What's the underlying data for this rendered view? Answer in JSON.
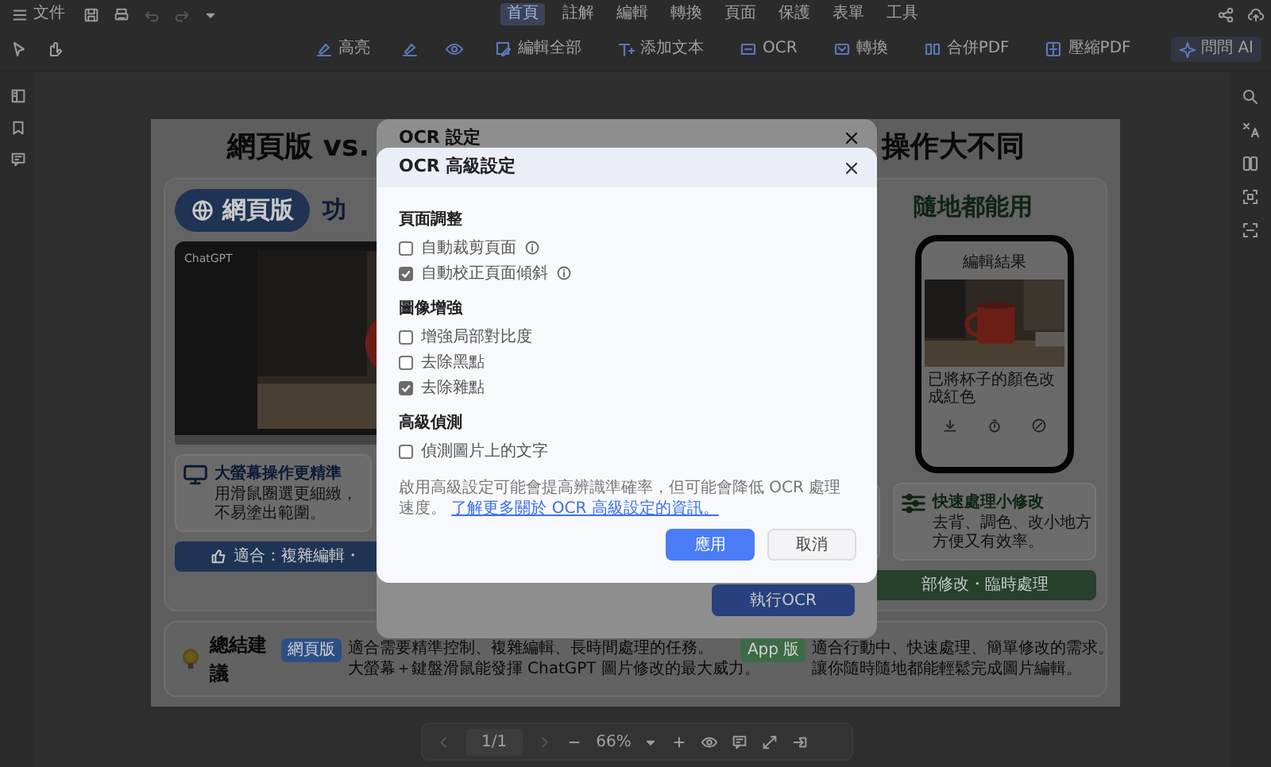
{
  "menu_bar": {
    "file_label": "文件",
    "tabs": [
      {
        "label": "首頁",
        "selected": true
      },
      {
        "label": "註解",
        "selected": false
      },
      {
        "label": "編輯",
        "selected": false
      },
      {
        "label": "轉換",
        "selected": false
      },
      {
        "label": "頁面",
        "selected": false
      },
      {
        "label": "保護",
        "selected": false
      },
      {
        "label": "表單",
        "selected": false
      },
      {
        "label": "工具",
        "selected": false
      }
    ]
  },
  "toolbar": {
    "tools": [
      {
        "kind": "labeled",
        "label": "高亮"
      },
      {
        "kind": "icon"
      },
      {
        "kind": "icon"
      },
      {
        "kind": "labeled",
        "label": "編輯全部"
      },
      {
        "kind": "labeled",
        "label": "添加文本"
      },
      {
        "kind": "labeled",
        "label": "OCR"
      },
      {
        "kind": "labeled",
        "label": "轉換"
      },
      {
        "kind": "labeled",
        "label": "合併PDF"
      },
      {
        "kind": "labeled",
        "label": "壓縮PDF"
      }
    ],
    "ai_button": "問問 AI"
  },
  "document": {
    "title_left": "網頁版 vs.",
    "title_right": "操作大不同",
    "web_card": {
      "badge": "網頁版",
      "next_heading": "功",
      "laptop_app": "ChatGPT",
      "feature": {
        "title": "大螢幕操作更精準",
        "lines": [
          "用滑鼠圈選更細緻，",
          "不易塗出範圍。"
        ]
      },
      "footer": "適合：複雜編輯・"
    },
    "app_card": {
      "heading": "隨地都能用",
      "phone_title": "編輯結果",
      "phone_caption": "已將杯子的顏色改成紅色",
      "feature": {
        "title": "快速處理小修改",
        "lines": [
          "去背、調色、改小地方",
          "方便又有效率。"
        ]
      },
      "footer": "部修改・臨時處理"
    },
    "summary": {
      "title": "總結建議",
      "items": [
        {
          "badge": "網頁版",
          "color": "#2c4f86",
          "lines": [
            "適合需要精準控制、複雜編輯、長時間處理的任務。",
            "大螢幕＋鍵盤滑鼠能發揮 ChatGPT 圖片修改的最大威力。"
          ]
        },
        {
          "badge": "App 版",
          "color": "#3d6b47",
          "lines": [
            "適合行動中、快速處理、簡單修改的需求。",
            "讓你隨時隨地都能輕鬆完成圖片編輯。"
          ]
        }
      ]
    }
  },
  "page_nav": {
    "page": "1/1",
    "zoom": "66%"
  },
  "ocr_dialog": {
    "title": "OCR 設定",
    "run_button": "執行OCR"
  },
  "advanced_dialog": {
    "title": "OCR 高級設定",
    "sections": [
      {
        "heading": "頁面調整",
        "options": [
          {
            "label": "自動裁剪頁面",
            "checked": false,
            "info": true
          },
          {
            "label": "自動校正頁面傾斜",
            "checked": true,
            "info": true
          }
        ]
      },
      {
        "heading": "圖像增強",
        "options": [
          {
            "label": "增強局部對比度",
            "checked": false,
            "info": false
          },
          {
            "label": "去除黑點",
            "checked": false,
            "info": false
          },
          {
            "label": "去除雜點",
            "checked": true,
            "info": false
          }
        ]
      },
      {
        "heading": "高級偵測",
        "options": [
          {
            "label": "偵測圖片上的文字",
            "checked": false,
            "info": false
          }
        ]
      }
    ],
    "note": "啟用高級設定可能會提高辨識準確率，但可能會降低 OCR 處理速度。",
    "note_link": "了解更多關於 OCR 高級設定的資訊。",
    "buttons": [
      {
        "label": "應用",
        "kind": "primary"
      },
      {
        "label": "取消",
        "kind": "secondary"
      }
    ]
  }
}
